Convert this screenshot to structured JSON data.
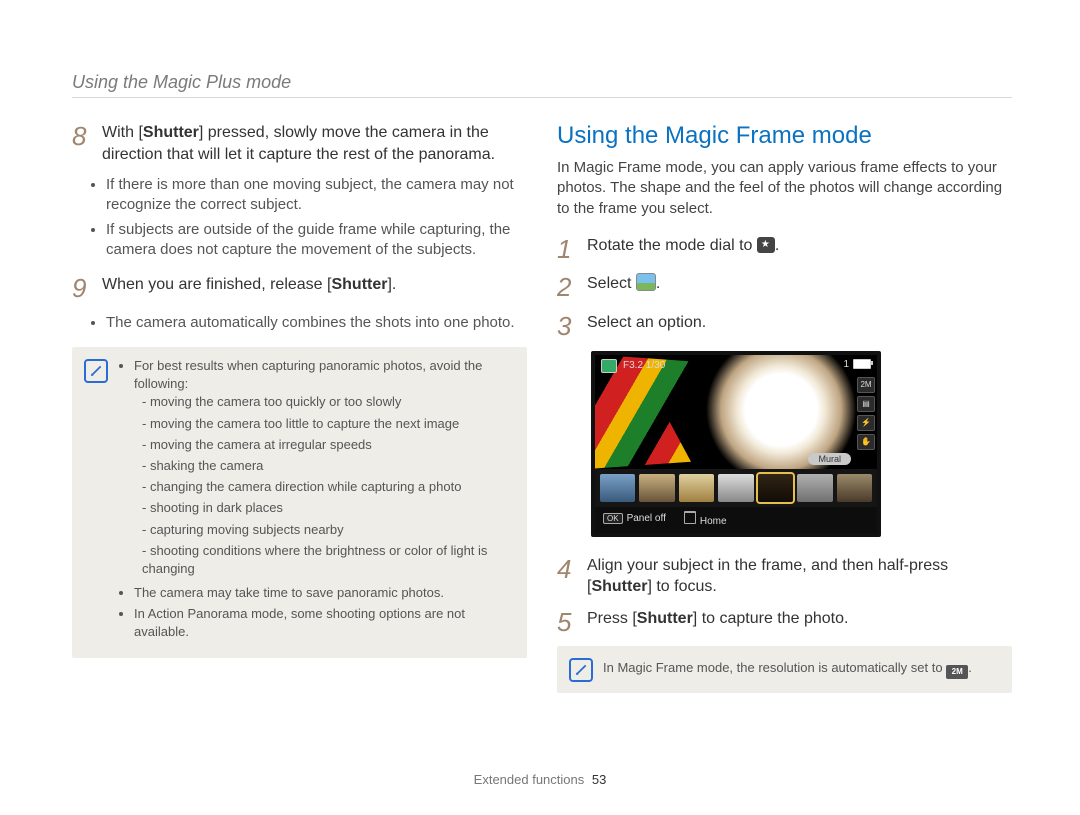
{
  "running_head": "Using the Magic Plus mode",
  "left": {
    "step8": {
      "num": "8",
      "line1a": "With [",
      "line1b": "Shutter",
      "line1c": "] pressed, slowly move the camera in the direction that will let it capture the rest of the panorama.",
      "sub1": "If there is more than one moving subject, the camera may not recognize the correct subject.",
      "sub2": "If subjects are outside of the guide frame while capturing, the camera does not capture the movement of the subjects."
    },
    "step9": {
      "num": "9",
      "line1a": "When you are finished, release [",
      "line1b": "Shutter",
      "line1c": "].",
      "sub1": "The camera automatically combines the shots into one photo."
    },
    "note": {
      "lead": "For best results when capturing panoramic photos, avoid the following:",
      "d1": "moving the camera too quickly or too slowly",
      "d2": "moving the camera too little to capture the next image",
      "d3": "moving the camera at irregular speeds",
      "d4": "shaking the camera",
      "d5": "changing the camera direction while capturing a photo",
      "d6": "shooting in dark places",
      "d7": "capturing moving subjects nearby",
      "d8": "shooting conditions where the brightness or color of light is changing",
      "b2": "The camera may take time to save panoramic photos.",
      "b3": "In Action Panorama mode, some shooting options are not available."
    }
  },
  "right": {
    "heading": "Using the Magic Frame mode",
    "intro": "In Magic Frame mode, you can apply various frame effects to your photos. The shape and the feel of the photos will change according to the frame you select.",
    "step1": {
      "num": "1",
      "text_a": "Rotate the mode dial to ",
      "text_b": "."
    },
    "step2": {
      "num": "2",
      "text_a": "Select ",
      "text_b": "."
    },
    "step3": {
      "num": "3",
      "text": "Select an option."
    },
    "lcd": {
      "top_text": "F3.2 1/30",
      "count": "1",
      "mural": "Mural",
      "panel_off_key": "OK",
      "panel_off": "Panel off",
      "home": "Home",
      "side1": "2M",
      "side4": "✋"
    },
    "step4": {
      "num": "4",
      "a": "Align your subject in the frame, and then half-press [",
      "b": "Shutter",
      "c": "] to focus."
    },
    "step5": {
      "num": "5",
      "a": "Press [",
      "b": "Shutter",
      "c": "] to capture the photo."
    },
    "note": {
      "a": "In Magic Frame mode, the resolution is automatically set to ",
      "res": "2M",
      "b": "."
    }
  },
  "footer": {
    "section": "Extended functions",
    "page": "53"
  }
}
